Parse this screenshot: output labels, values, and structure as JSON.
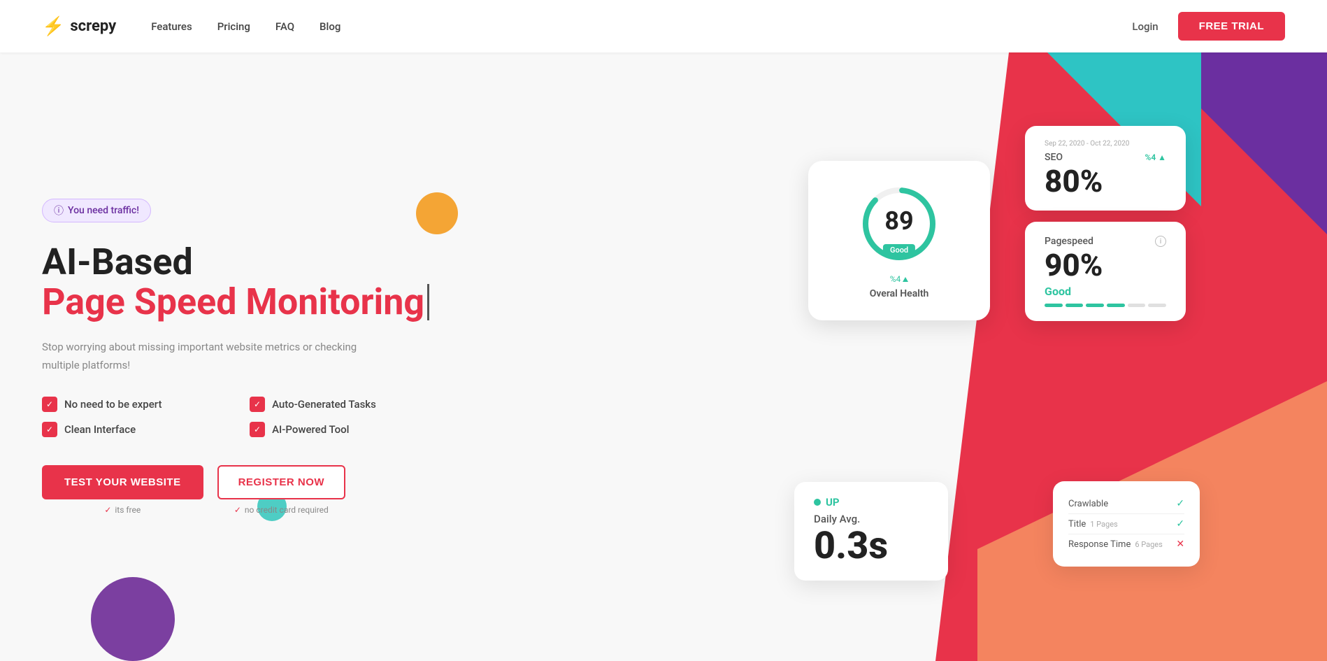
{
  "brand": {
    "name": "screpy",
    "logo_icon": "⚡"
  },
  "nav": {
    "links": [
      "Features",
      "Pricing",
      "FAQ",
      "Blog"
    ],
    "login": "Login",
    "free_trial": "FREE TRIAL"
  },
  "hero": {
    "badge": "You need traffic!",
    "title_dark": "AI-Based",
    "title_red": "Page Speed Monitoring",
    "subtitle": "Stop worrying about missing important website metrics or checking multiple platforms!",
    "features": [
      {
        "label": "No need to be expert"
      },
      {
        "label": "Auto-Generated Tasks"
      },
      {
        "label": "Clean Interface"
      },
      {
        "label": "AI-Powered Tool"
      }
    ],
    "btn_test": "TEST YOUR WEBSITE",
    "btn_register": "REGISTER NOW",
    "sub_test": "its free",
    "sub_register": "no credit card required"
  },
  "dashboard": {
    "health": {
      "score": "89",
      "percent": "%4",
      "label": "Overal Health",
      "status": "Good"
    },
    "daily": {
      "status": "UP",
      "label": "Daily Avg.",
      "value": "0.3s"
    },
    "seo": {
      "date": "Sep 22, 2020 - Oct 22, 2020",
      "title": "SEO",
      "value": "80%",
      "change": "%4 ▲"
    },
    "pagespeed": {
      "title": "Pagespeed",
      "value": "90%",
      "status": "Good",
      "progress": [
        1,
        1,
        1,
        1,
        0,
        0
      ]
    },
    "crawl": {
      "rows": [
        {
          "label": "Crawlable",
          "status": "check"
        },
        {
          "label": "Title",
          "sub": "1 Pages",
          "status": "check"
        },
        {
          "label": "Response Time",
          "sub": "6 Pages",
          "status": "x"
        }
      ]
    }
  }
}
